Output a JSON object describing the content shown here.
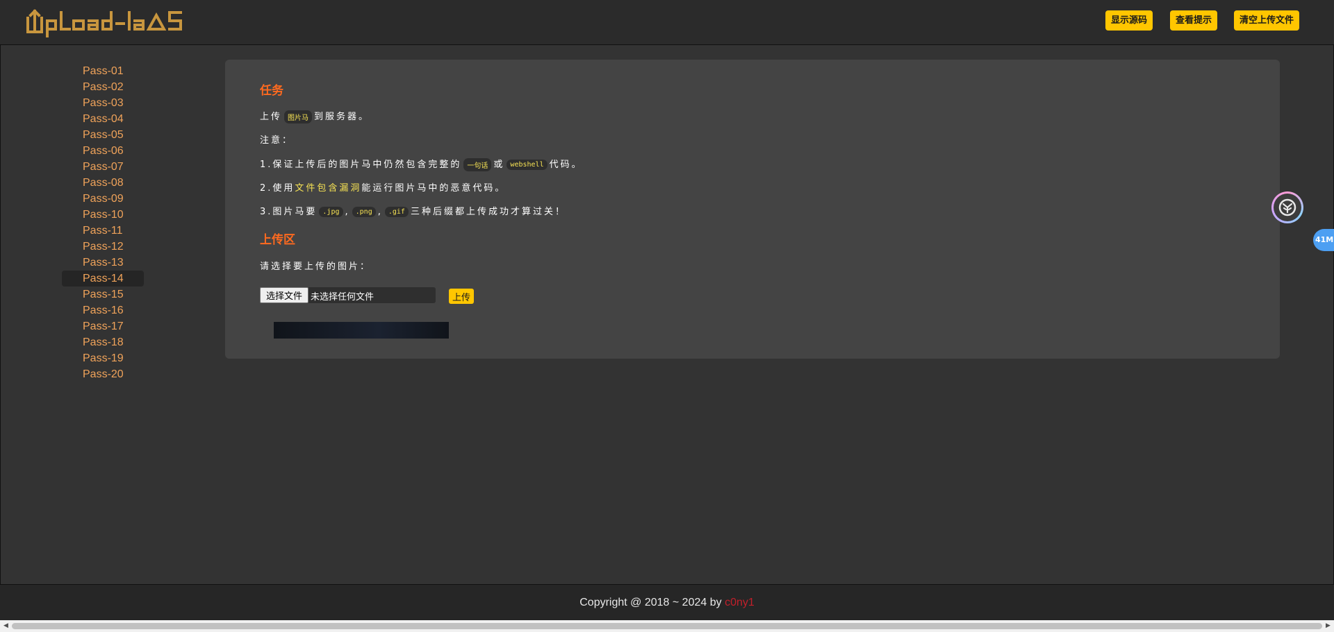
{
  "header": {
    "logo_alt": "Upload-labs",
    "buttons": {
      "show_source": "显示源码",
      "view_hint": "查看提示",
      "clear_uploads": "清空上传文件"
    }
  },
  "sidebar": {
    "active_index": 13,
    "items": [
      "Pass-01",
      "Pass-02",
      "Pass-03",
      "Pass-04",
      "Pass-05",
      "Pass-06",
      "Pass-07",
      "Pass-08",
      "Pass-09",
      "Pass-10",
      "Pass-11",
      "Pass-12",
      "Pass-13",
      "Pass-14",
      "Pass-15",
      "Pass-16",
      "Pass-17",
      "Pass-18",
      "Pass-19",
      "Pass-20"
    ]
  },
  "task": {
    "title": "任务",
    "line1_pre": "上传",
    "line1_tag": "图片马",
    "line1_post": "到服务器。",
    "note": "注意：",
    "rule1_pre": "1.保证上传后的图片马中仍然包含完整的",
    "rule1_tag1": "一句话",
    "rule1_mid": "或",
    "rule1_tag2": "webshell",
    "rule1_post": "代码。",
    "rule2_pre": "2.使用",
    "rule2_link": "文件包含漏洞",
    "rule2_post": "能运行图片马中的恶意代码。",
    "rule3_pre": "3.图片马要",
    "rule3_tag1": ".jpg",
    "rule3_sep1": ",",
    "rule3_tag2": ".png",
    "rule3_sep2": ",",
    "rule3_tag3": ".gif",
    "rule3_post": "三种后缀都上传成功才算过关！"
  },
  "upload": {
    "title": "上传区",
    "prompt": "请选择要上传的图片：",
    "choose_file": "选择文件",
    "no_file": "未选择任何文件",
    "submit": "上传"
  },
  "widgets": {
    "memory_badge": "41M"
  },
  "footer": {
    "text": "Copyright @ 2018 ~ 2024 by ",
    "author": "c0ny1"
  },
  "colors": {
    "accent": "#ffc600",
    "link": "#f0a35a",
    "title": "#ff6a1f",
    "tag_text": "#f7e354"
  }
}
